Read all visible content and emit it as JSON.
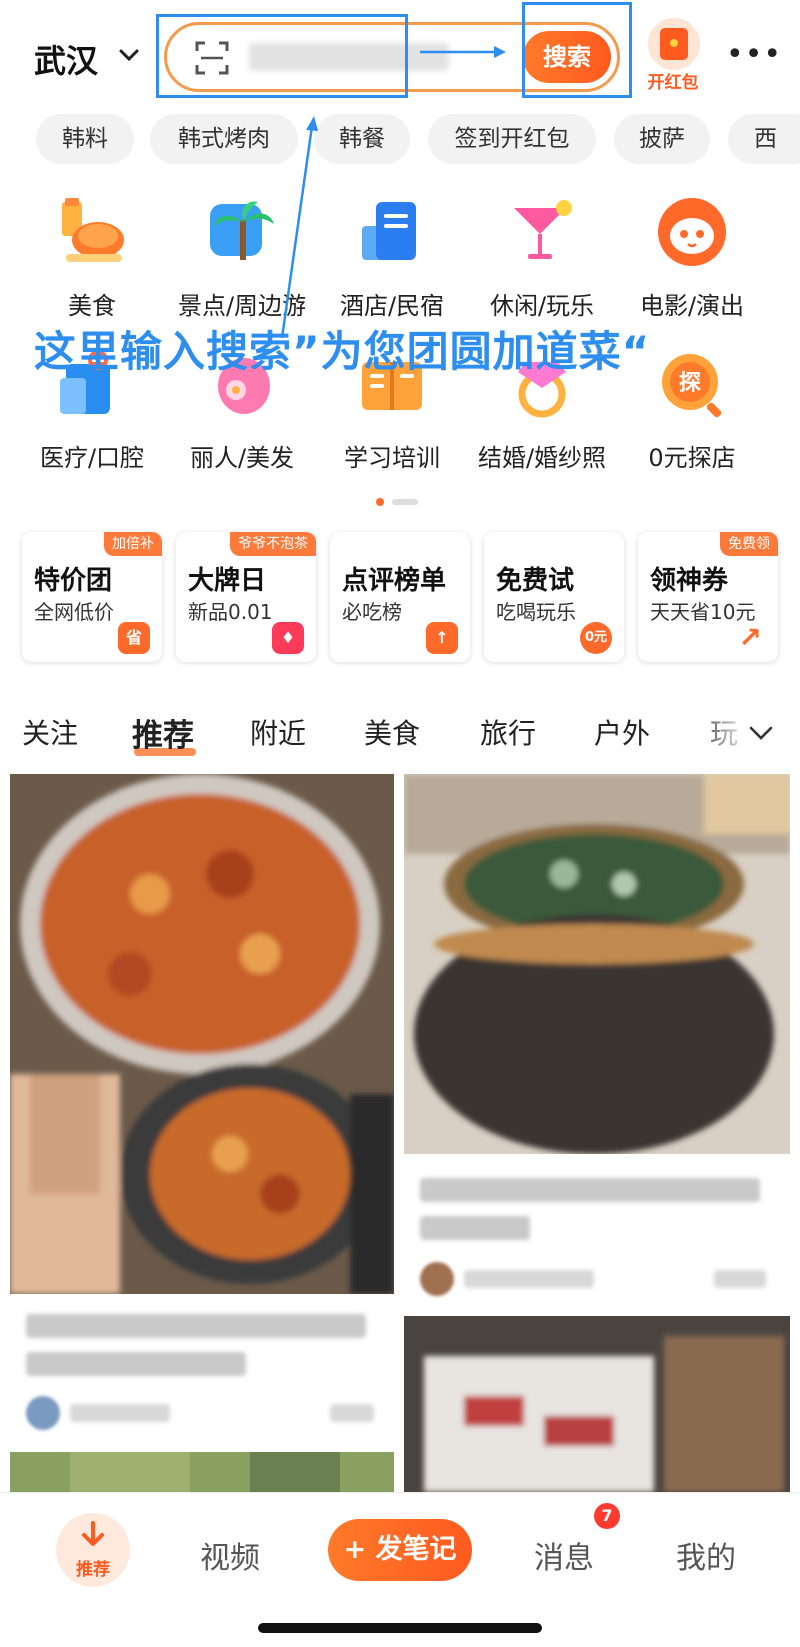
{
  "header": {
    "city": "武汉",
    "search_button": "搜索",
    "hongbao_label": "开红包"
  },
  "annotation": {
    "text": "这里输入搜索”为您团圆加道菜“"
  },
  "chips": [
    "韩料",
    "韩式烤肉",
    "韩餐",
    "签到开红包",
    "披萨",
    "西"
  ],
  "categories": [
    {
      "label": "美食",
      "icon": "food-icon"
    },
    {
      "label": "景点/周边游",
      "icon": "palm-tree-icon"
    },
    {
      "label": "酒店/民宿",
      "icon": "hotel-icon"
    },
    {
      "label": "休闲/玩乐",
      "icon": "cocktail-icon"
    },
    {
      "label": "电影/演出",
      "icon": "cat-face-icon"
    },
    {
      "label": "医疗/口腔",
      "icon": "medical-icon"
    },
    {
      "label": "丽人/美发",
      "icon": "beauty-icon"
    },
    {
      "label": "学习培训",
      "icon": "book-icon"
    },
    {
      "label": "结婚/婚纱照",
      "icon": "diamond-ring-icon"
    },
    {
      "label": "0元探店",
      "icon": "explore-icon"
    }
  ],
  "promos": [
    {
      "title": "特价团",
      "subtitle": "全网低价",
      "badge": "加倍补",
      "icon_text": "省"
    },
    {
      "title": "大牌日",
      "subtitle": "新品0.01",
      "badge": "爷爷不泡茶",
      "icon_text": "♦"
    },
    {
      "title": "点评榜单",
      "subtitle": "必吃榜",
      "badge": "",
      "icon_text": "↑"
    },
    {
      "title": "免费试",
      "subtitle": "吃喝玩乐",
      "badge": "",
      "icon_text": "0元"
    },
    {
      "title": "领神券",
      "subtitle": "天天省10元",
      "badge": "免费领",
      "icon_text": "↗"
    }
  ],
  "feed_tabs": [
    "关注",
    "推荐",
    "附近",
    "美食",
    "旅行",
    "户外",
    "玩"
  ],
  "bottom_nav": {
    "home": "推荐",
    "video": "视频",
    "post": "+ 发笔记",
    "messages": "消息",
    "messages_badge": "7",
    "profile": "我的"
  },
  "colors": {
    "accent": "#ff5a1f",
    "annotation": "#2d8ef0"
  }
}
